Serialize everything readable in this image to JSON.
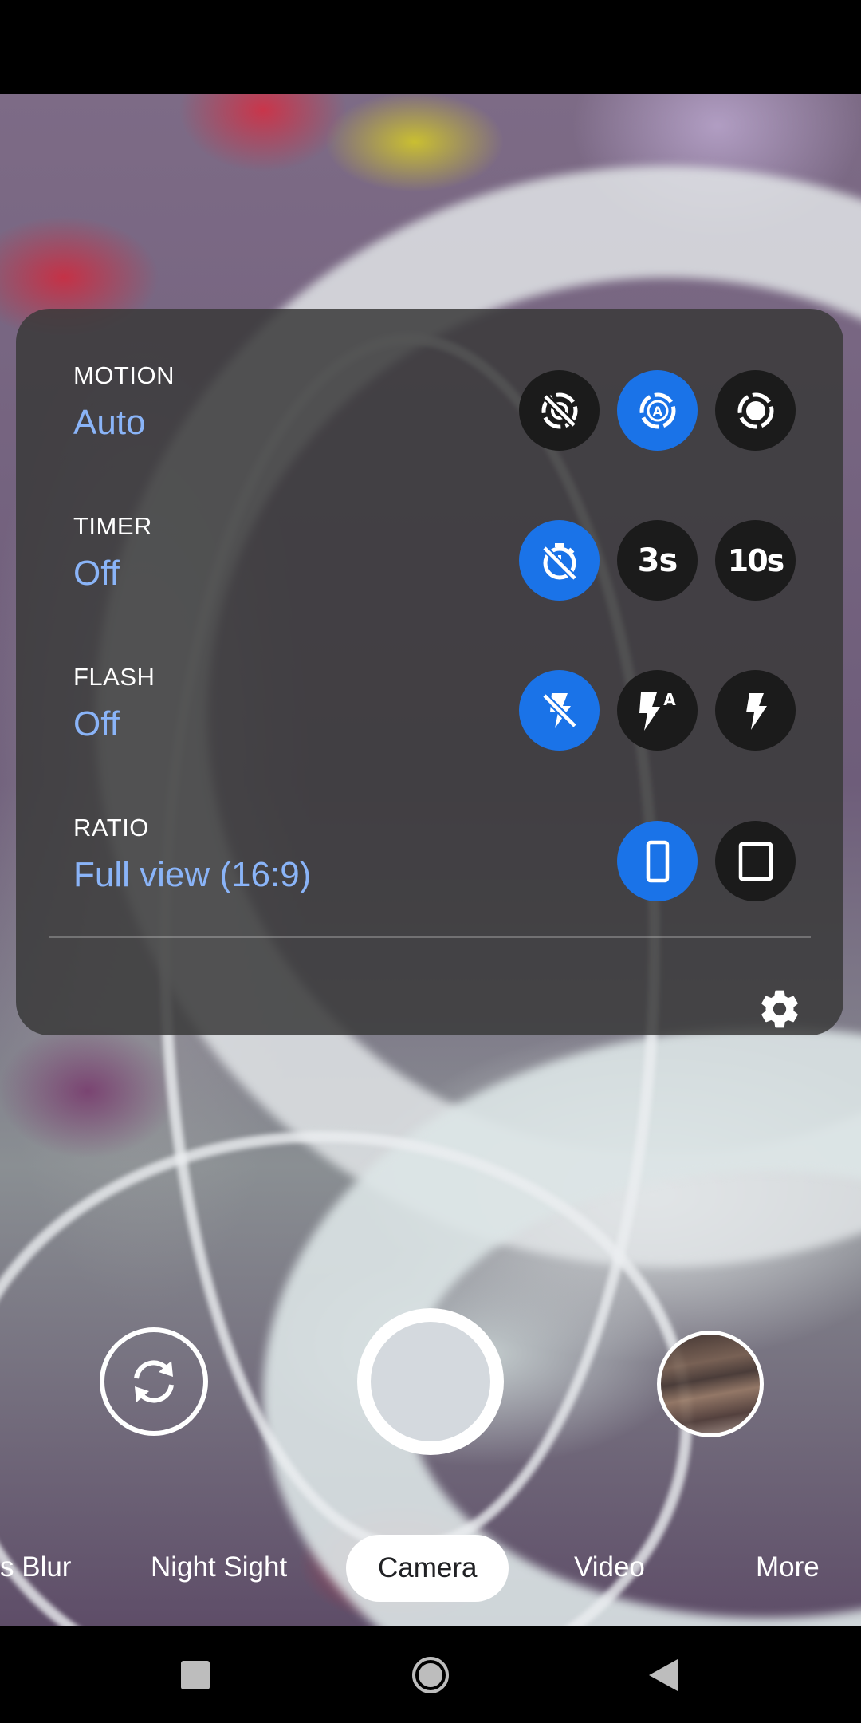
{
  "settings": {
    "motion": {
      "name": "MOTION",
      "value": "Auto",
      "options": [
        "motion-off-icon",
        "motion-auto-icon",
        "motion-on-icon"
      ],
      "selected": 1
    },
    "timer": {
      "name": "TIMER",
      "value": "Off",
      "options": [
        "timer-off-icon",
        "3s",
        "10s"
      ],
      "selected": 0
    },
    "flash": {
      "name": "FLASH",
      "value": "Off",
      "options": [
        "flash-off-icon",
        "flash-auto-icon",
        "flash-on-icon"
      ],
      "selected": 0
    },
    "ratio": {
      "name": "RATIO",
      "value": "Full view (16:9)",
      "options": [
        "ratio-full-icon",
        "ratio-4-3-icon"
      ],
      "selected": 0
    }
  },
  "timer_labels": {
    "three": "3s",
    "ten": "10s"
  },
  "modes": {
    "portrait": "s Blur",
    "night": "Night Sight",
    "camera": "Camera",
    "video": "Video",
    "more": "More"
  },
  "colors": {
    "accent": "#1a73e8",
    "value_text": "#8ab4f8",
    "panel": "#3a3a3a"
  }
}
